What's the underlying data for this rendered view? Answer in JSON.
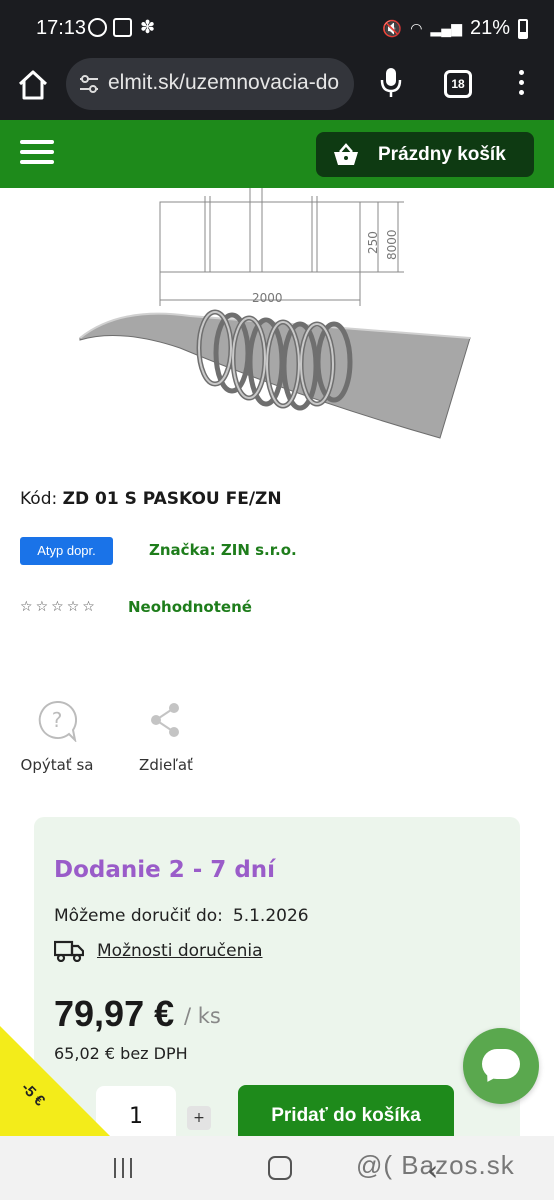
{
  "status_bar": {
    "time": "17:13",
    "battery": "21%"
  },
  "browser": {
    "url": "elmit.sk/uzemnovacia-do",
    "tab_count": "18"
  },
  "header": {
    "cart_label": "Prázdny košík",
    "colors": {
      "brand_green": "#1e8a1b",
      "cart_dark": "#0e3a12"
    }
  },
  "product": {
    "drawing": {
      "dim_width": "2000",
      "dim_250": "250",
      "dim_8000": "8000"
    },
    "code_prefix": "Kód:",
    "code": "ZD 01 S PASKOU FE/ZN",
    "badge": "Atyp dopr.",
    "brand": "Značka: ZIN s.r.o.",
    "stars": [
      "☆",
      "☆",
      "☆",
      "☆",
      "☆"
    ],
    "rating_label": "Neohodnotené"
  },
  "actions": {
    "ask": "Opýtať sa",
    "share": "Zdieľať"
  },
  "delivery": {
    "title": "Dodanie 2 - 7 dní",
    "date_label": "Môžeme doručiť do:",
    "date_value": "5.1.2026",
    "options_link": "Možnosti doručenia",
    "price": "79,97 €",
    "unit": "/ ks",
    "price_net": "65,02 € bez DPH",
    "quantity": "1",
    "plus": "+",
    "add_to_cart": "Pridať do košíka"
  },
  "discount_label": "-5 €",
  "watermark": "@( Bazos.sk"
}
